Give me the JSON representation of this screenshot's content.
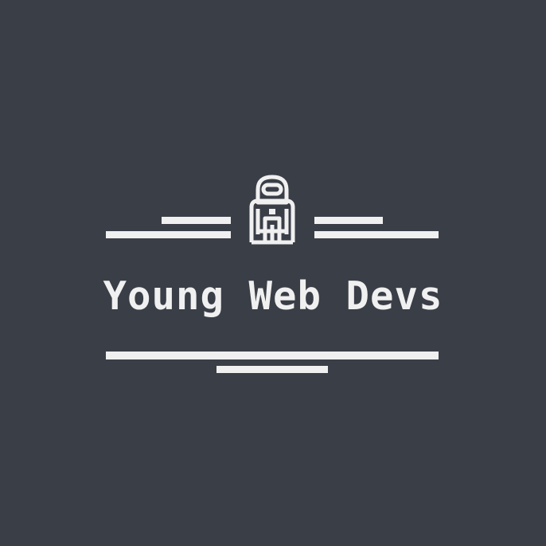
{
  "logo": {
    "brand_name": "Young Web Devs",
    "icon": "astronaut-icon",
    "colors": {
      "background": "#3a3e47",
      "foreground": "#f0f0f0"
    }
  }
}
